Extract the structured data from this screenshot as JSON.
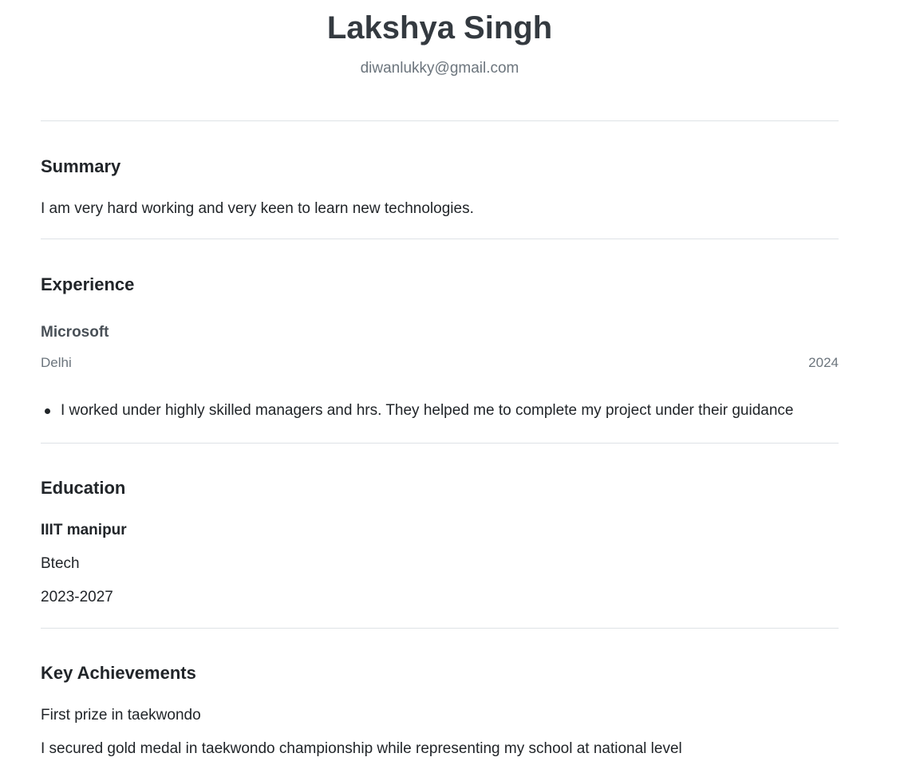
{
  "header": {
    "name": "Lakshya Singh",
    "email": "diwanlukky@gmail.com"
  },
  "summary": {
    "title": "Summary",
    "text": "I am very hard working and very keen to learn new technologies."
  },
  "experience": {
    "title": "Experience",
    "items": [
      {
        "company": "Microsoft",
        "location": "Delhi",
        "year": "2024",
        "bullets": [
          "I worked under highly skilled managers and hrs. They helped me to complete my project under their guidance"
        ]
      }
    ]
  },
  "education": {
    "title": "Education",
    "items": [
      {
        "school": "IIIT manipur",
        "degree": "Btech",
        "years": "2023-2027"
      }
    ]
  },
  "achievements": {
    "title": "Key Achievements",
    "items": [
      {
        "title": "First prize in taekwondo",
        "description": "I secured gold medal in taekwondo championship while representing my school at national level"
      }
    ]
  }
}
